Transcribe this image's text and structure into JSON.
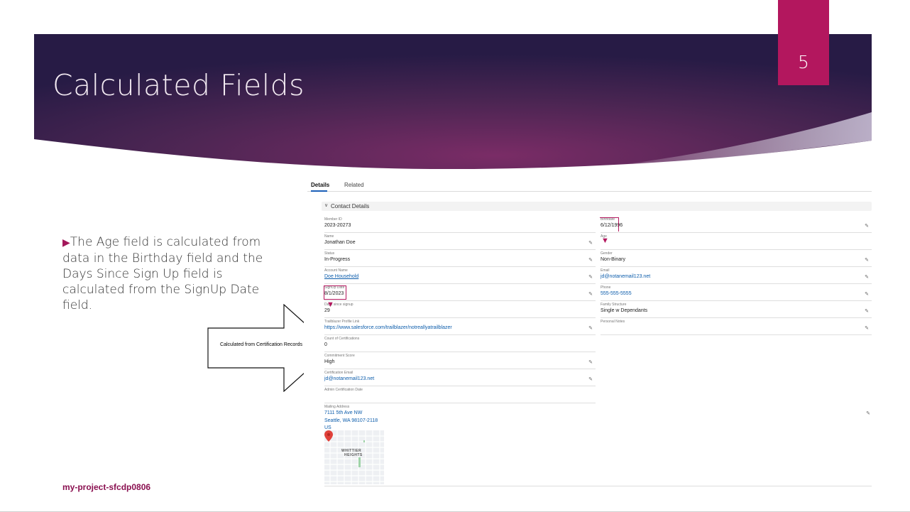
{
  "slide": {
    "title": "Calculated Fields",
    "number": "5",
    "bullet": "The Age field is calculated from data in the Birthday field and the Days Since Sign Up field is calculated from the SignUp Date field.",
    "footer": "my-project-sfcdp0806",
    "callout": "Calculated from Certification Records"
  },
  "colors": {
    "accent": "#b3175e",
    "banner_dark": "#2a1d47",
    "banner_mid": "#6b2b63",
    "link": "#0b5cab"
  },
  "record": {
    "tabs": [
      {
        "label": "Details",
        "active": true
      },
      {
        "label": "Related",
        "active": false
      }
    ],
    "section": "Contact Details",
    "left_fields": [
      {
        "label": "Member ID",
        "value": "2023-20273",
        "link": false,
        "editable": false
      },
      {
        "label": "Name",
        "value": "Jonathan Doe",
        "link": false,
        "editable": true
      },
      {
        "label": "Status",
        "value": "In-Progress",
        "link": false,
        "editable": true
      },
      {
        "label": "Account Name",
        "value": "Doe Household",
        "link": true,
        "editable": true
      },
      {
        "label": "SignUp Date",
        "value": "8/1/2023",
        "link": false,
        "editable": true
      },
      {
        "label": "Days since signup",
        "value": "29",
        "link": false,
        "editable": false
      },
      {
        "label": "Trailblazer Profile Link",
        "value": "https://www.salesforce.com/trailblazer/notreallyatrailblazer",
        "link": true,
        "editable": true
      },
      {
        "label": "Count of Certifications",
        "value": "0",
        "link": false,
        "editable": false
      },
      {
        "label": "Commitment Score",
        "value": "High",
        "link": false,
        "editable": true
      },
      {
        "label": "Certification Email",
        "value": "jd@notanemail123.net",
        "link": true,
        "editable": true
      },
      {
        "label": "Admin Certification Date",
        "value": "",
        "link": false,
        "editable": false
      }
    ],
    "right_fields": [
      {
        "label": "Birthdate",
        "value": "6/12/1996",
        "link": false,
        "editable": true
      },
      {
        "label": "Age",
        "value": "",
        "link": false,
        "editable": false
      },
      {
        "label": "Gender",
        "value": "Non-Binary",
        "link": false,
        "editable": true
      },
      {
        "label": "Email",
        "value": "jd@notanemail123.net",
        "link": true,
        "editable": true
      },
      {
        "label": "Phone",
        "value": "555-555-5555",
        "link": true,
        "editable": true
      },
      {
        "label": "Family Structure",
        "value": "Single w Dependants",
        "link": false,
        "editable": true
      },
      {
        "label": "Personal Notes",
        "value": "",
        "link": false,
        "editable": true
      }
    ],
    "mailing": {
      "label": "Mailing Address",
      "lines": [
        "7111 5th Ave NW",
        "Seattle, WA 98107-2118",
        "US"
      ],
      "map_label_1": "WHITTIER",
      "map_label_2": "HEIGHTS"
    },
    "icons": {
      "edit": "pencil-icon",
      "section": "chevron-down-icon",
      "map": "map-pin-icon"
    }
  }
}
